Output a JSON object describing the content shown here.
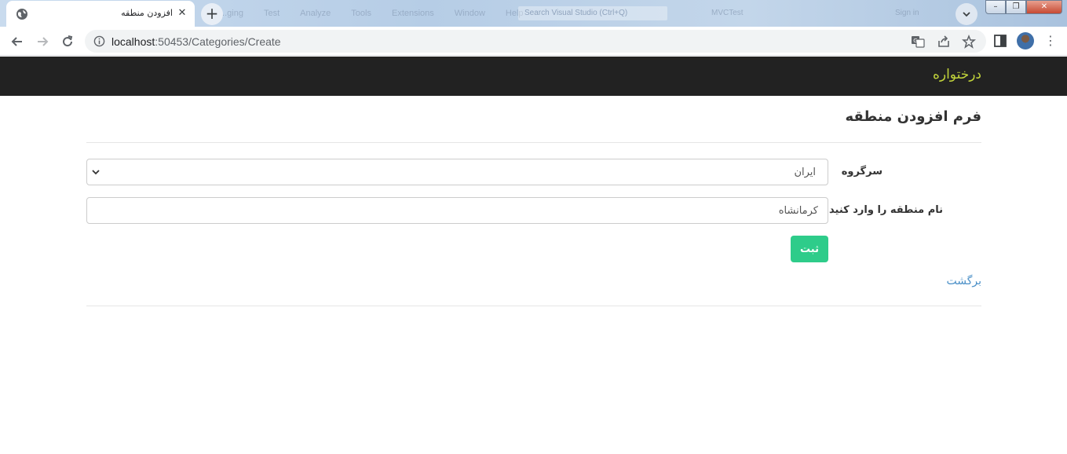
{
  "browser": {
    "tab_title": "افزودن منطقه",
    "url_host": "localhost",
    "url_rest": ":50453/Categories/Create",
    "background_menu": [
      "...ging",
      "Test",
      "Analyze",
      "Tools",
      "Extensions",
      "Window",
      "Help"
    ],
    "background_search": "Search Visual Studio (Ctrl+Q)",
    "background_project": "MVCTest",
    "background_signin": "Sign in",
    "icons": [
      "globe-icon",
      "close-icon",
      "plus-icon",
      "chevron-down-icon",
      "back-arrow-icon",
      "forward-arrow-icon",
      "reload-icon",
      "info-icon",
      "translate-icon",
      "share-icon",
      "star-icon",
      "side-panel-icon",
      "kebab-menu-icon"
    ]
  },
  "navbar": {
    "brand": "درختواره",
    "brand_color": "#c2d43b",
    "background": "#222222"
  },
  "form": {
    "title": "فرم افزودن منطقه",
    "parent_label": "سرگروه",
    "parent_value": "ایران",
    "name_label": "نام منطقه را وارد کنید",
    "name_value": "کرمانشاه",
    "submit_label": "ثبت",
    "submit_color": "#2ecc8a",
    "back_link": "برگشت"
  }
}
